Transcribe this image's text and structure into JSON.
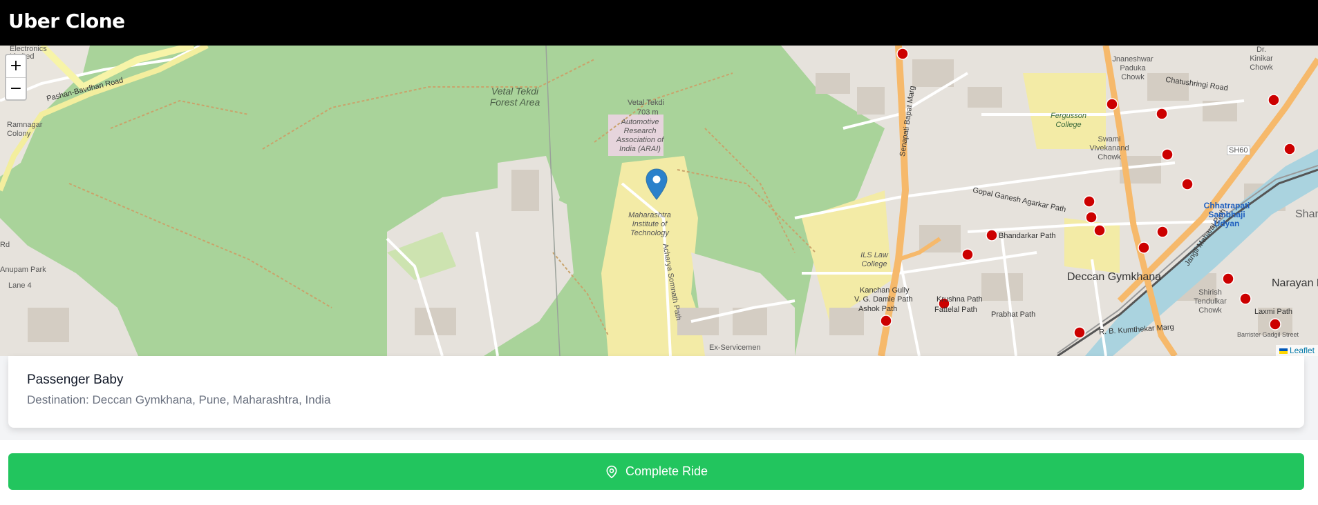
{
  "app": {
    "title": "Uber Clone"
  },
  "map": {
    "zoom_in_label": "+",
    "zoom_out_label": "−",
    "attribution": "Leaflet",
    "labels": {
      "pashan_road": "Pashan-Bavdhan Road",
      "electronics": "Electronics Limited",
      "ramnagar": "Ramnagar Colony",
      "rd": "Rd",
      "anupam_park": "Anupam Park",
      "lane4": "Lane 4",
      "vetal_forest": "Vetal Tekdi Forest Area",
      "vetal_tekdi": "Vetal Tekdi",
      "elevation": "703 m",
      "arai": "Automotive Research Association of India (ARAI)",
      "mit": "Maharashtra Institute of Technology",
      "somnath_path": "Acharya Somnath Path",
      "ex_servicemen": "Ex-Servicemen",
      "senapati": "Senapati Bapat Marg",
      "fergusson": "Fergusson College",
      "swami": "Swami Vivekanand Chowk",
      "gopal": "Gopal Ganesh Agarkar Path",
      "bhandarkar": "Bhandarkar Path",
      "ils": "ILS Law College",
      "kanchan": "Kanchan Gully",
      "damle": "V. G. Damle Path",
      "ashok": "Ashok Path",
      "krushna": "Krushna Path",
      "fattelal": "Fattelal Path",
      "prabhat": "Prabhat Path",
      "deccan": "Deccan Gymkhana",
      "dnyaneshwar": "Jnaneshwar Paduka Chowk",
      "chaturshringi": "Chatushringi Road",
      "kinikar": "Dr. Kinikar Chowk",
      "sh60": "SH60",
      "jangli": "Jangli Maharaj Path",
      "sambhaji": "Chhatrapati Sambhaji Udyan",
      "shirish": "Shirish Tendulkar Chowk",
      "laxmi": "Laxmi Path",
      "narayan": "Narayan Pe",
      "kumthekar": "R. B. Kumthekar Marg",
      "barrister": "Barrister Gadgil Street",
      "shaniv": "Shaniv"
    }
  },
  "ride": {
    "passenger": "Passenger Baby",
    "destination": "Destination: Deccan Gymkhana, Pune, Maharashtra, India"
  },
  "actions": {
    "complete_label": "Complete Ride"
  },
  "colors": {
    "accent": "#22c55e",
    "header": "#000000",
    "park": "#a9d39a",
    "urban": "#e6e2dc",
    "major_road": "#f6b96b"
  },
  "icons": {
    "marker": "map-pin-icon",
    "complete": "map-pin-outline-icon",
    "hospital": "hospital-cross-icon"
  }
}
